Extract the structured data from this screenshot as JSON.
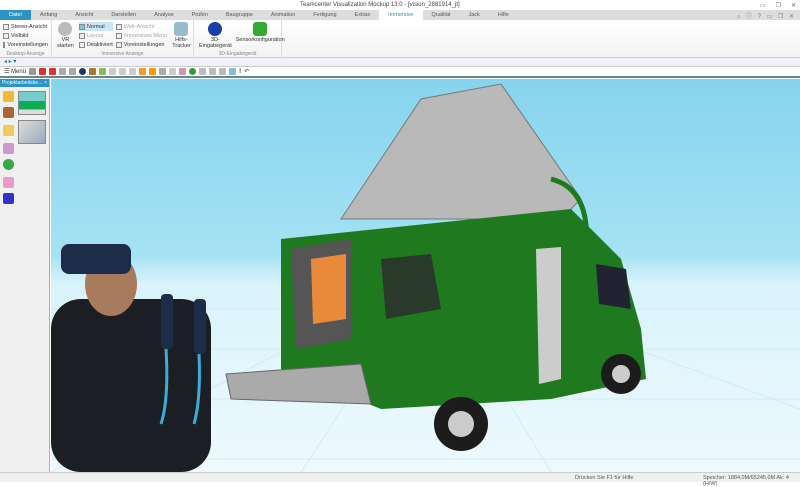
{
  "title": "Teamcenter Visualization Mockup 13.0 - [vision_2881914_jt]",
  "window_controls": [
    "minimize",
    "restore",
    "close"
  ],
  "tabs": [
    "Datei",
    "Anfang",
    "Ansicht",
    "Darstellen",
    "Analyse",
    "Prüfen",
    "Baugruppe",
    "Animation",
    "Fertigung",
    "Extras",
    "Immersive",
    "Qualität",
    "Jack",
    "Hilfe"
  ],
  "active_tab": "Immersive",
  "ribbon": {
    "desktop": {
      "items": [
        "Stereo-Ansicht",
        "Vollbild",
        "Voreinstellungen"
      ],
      "label": "Desktop-Anzeige"
    },
    "immersive": {
      "vr": "VR starten",
      "col1": [
        "Normal",
        "Layout",
        "Deaktiviert"
      ],
      "col2": [
        "Welt-Ansicht",
        "Immersives Menü",
        "Voreinstellungen"
      ],
      "tracker": "Hilfs-Tracker",
      "label": "Immersive Anzeige"
    },
    "device": {
      "items": [
        "3D-Eingabegerät",
        "Sensorkonfiguration"
      ],
      "label": "3D-Eingabegerät"
    }
  },
  "toolbar": {
    "menu": "Menü"
  },
  "left_panel": {
    "title": "Projektarbeitsbe...",
    "close": "×"
  },
  "status": {
    "help": "Drücken Sie F1 für Hilfe",
    "memory": "Speicher: 1884,0M/65245,0M  Ak: 4 (H/W)"
  },
  "colors": {
    "accent": "#2c93c5",
    "sky": "#86d4ee",
    "van": "#1f7a1f"
  }
}
